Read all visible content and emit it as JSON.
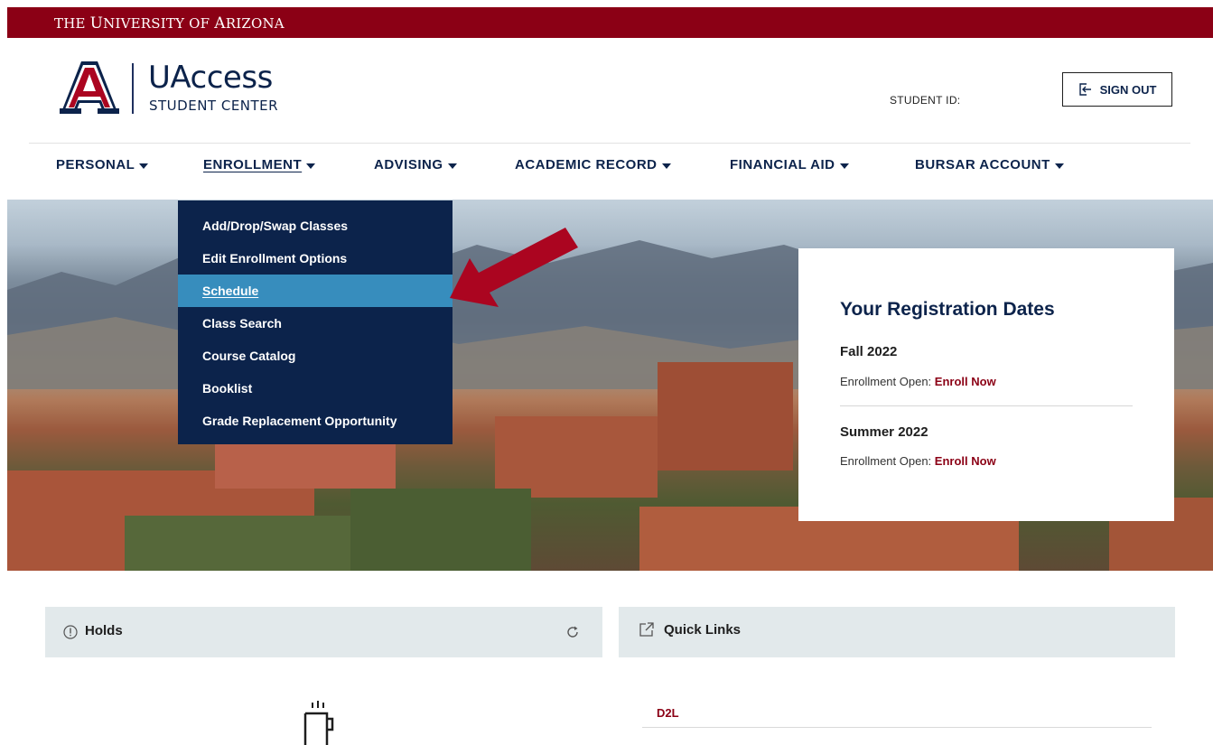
{
  "topbar": {
    "university": "The University of Arizona"
  },
  "brand": {
    "title": "UAccess",
    "subtitle": "STUDENT CENTER"
  },
  "header": {
    "student_id_label": "STUDENT ID:",
    "signout_label": "SIGN OUT"
  },
  "nav": [
    {
      "label": "PERSONAL"
    },
    {
      "label": "ENROLLMENT"
    },
    {
      "label": "ADVISING"
    },
    {
      "label": "ACADEMIC RECORD"
    },
    {
      "label": "FINANCIAL AID"
    },
    {
      "label": "BURSAR ACCOUNT"
    }
  ],
  "enrollment_menu": [
    {
      "label": "Add/Drop/Swap Classes"
    },
    {
      "label": "Edit Enrollment Options"
    },
    {
      "label": "Schedule"
    },
    {
      "label": "Class Search"
    },
    {
      "label": "Course Catalog"
    },
    {
      "label": "Booklist"
    },
    {
      "label": "Grade Replacement Opportunity"
    }
  ],
  "registration": {
    "title": "Your Registration Dates",
    "terms": [
      {
        "name": "Fall 2022",
        "status": "Enrollment Open:",
        "link": "Enroll Now"
      },
      {
        "name": "Summer 2022",
        "status": "Enrollment Open:",
        "link": "Enroll Now"
      }
    ]
  },
  "holds": {
    "title": "Holds"
  },
  "quick_links": {
    "title": "Quick Links",
    "items": [
      {
        "label": "D2L"
      }
    ]
  },
  "colors": {
    "brand_red": "#8b0015",
    "navy": "#0c234b",
    "highlight_blue": "#378dbd"
  }
}
